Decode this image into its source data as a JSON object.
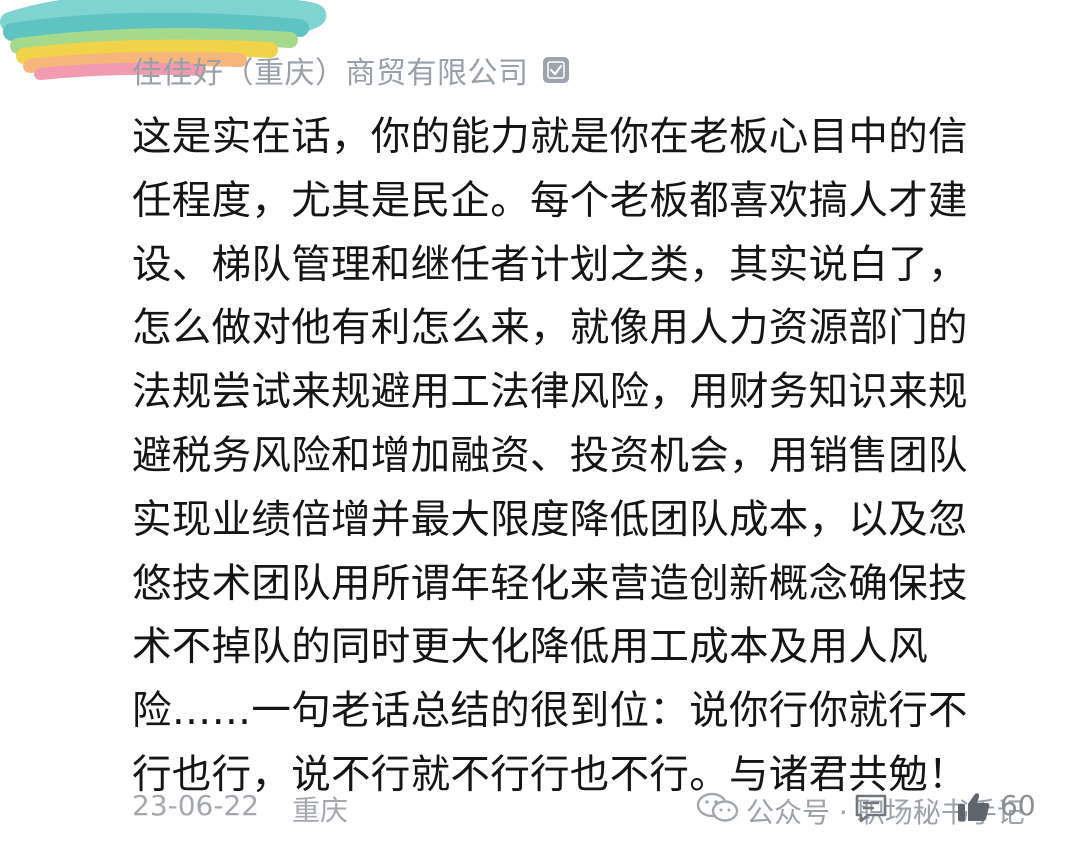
{
  "comment": {
    "company": "佳佳好（重庆）商贸有限公司",
    "verified_icon": "verified-badge-icon",
    "lines": [
      "这是实在话，你的能力就是你在老板心目中的信",
      "任程度，尤其是民企。每个老板都喜欢搞人才建",
      "设、梯队管理和继任者计划之类，其实说白了，",
      "怎么做对他有利怎么来，就像用人力资源部门的",
      "法规尝试来规避用工法律风险，用财务知识来规",
      "避税务风险和增加融资、投资机会，用销售团队",
      "实现业绩倍增并最大限度降低团队成本，以及忽",
      "悠技术团队用所谓年轻化来营造创新概念确保技",
      "术不掉队的同时更大化降低用工成本及用人风",
      "险……一句老话总结的很到位：说你行你就行不",
      "行也行，说不行就不行行也不行。与诸君共勉！"
    ],
    "date": "23-06-22",
    "location": "重庆",
    "like_count": "60"
  },
  "watermark": {
    "text": "公众号 · 职场秘书手记",
    "icon": "wechat-icon"
  },
  "icons": {
    "comment": "comment-icon",
    "like": "thumbs-up-icon"
  },
  "colors": {
    "text": "#151515",
    "muted": "#9aa0a8",
    "scribble_teal": "#5fc4c1",
    "scribble_yellow": "#f1d34a",
    "scribble_pink": "#f29bb0"
  }
}
